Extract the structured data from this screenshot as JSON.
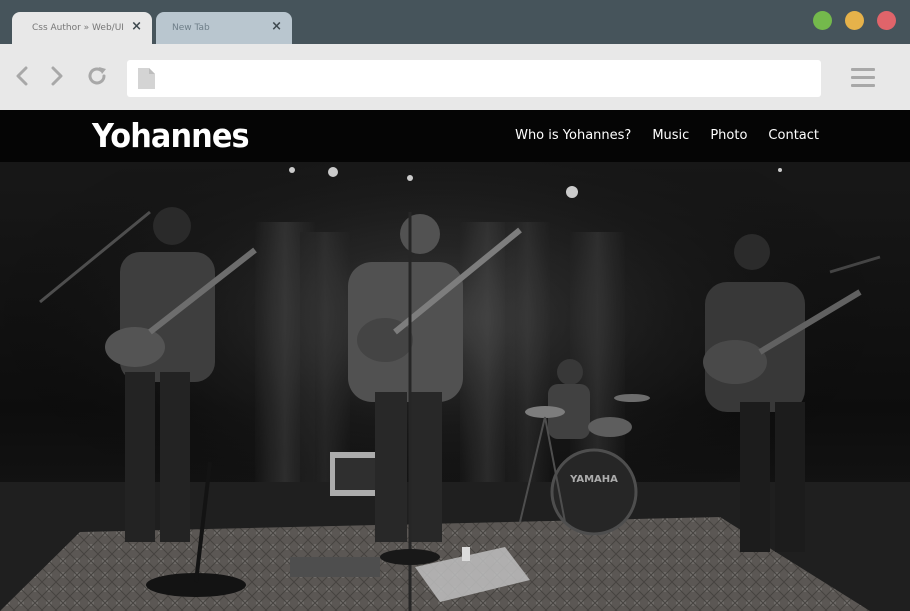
{
  "browser": {
    "tabs": [
      {
        "label": "Css Author » Web/UI",
        "close": "×"
      },
      {
        "label": "New Tab",
        "close": "×"
      }
    ],
    "address": "",
    "colors": {
      "green": "#74b94c",
      "yellow": "#e6b24a",
      "red": "#e0646a"
    }
  },
  "site": {
    "logo": "Yohannes",
    "nav": [
      "Who is Yohannes?",
      "Music",
      "Photo",
      "Contact"
    ]
  },
  "hero": {
    "image": "black-and-white photo of a band performing on stage: guitarist, singer with guitar, drummer with YAMAHA drum kit, bassist",
    "drum_brand": "YAMAHA"
  }
}
